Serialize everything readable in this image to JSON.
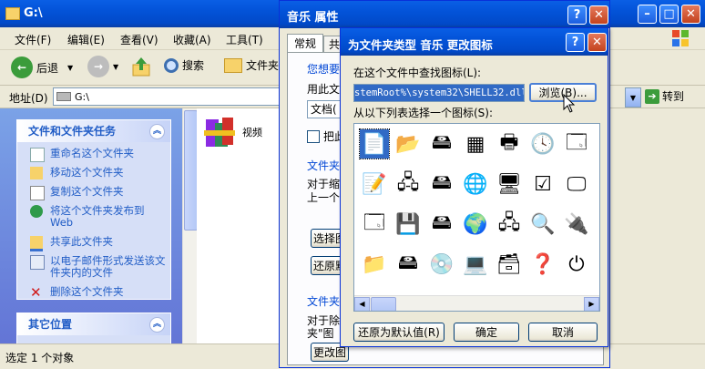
{
  "explorer": {
    "title": "G:\\",
    "menu": [
      "文件(F)",
      "编辑(E)",
      "查看(V)",
      "收藏(A)",
      "工具(T)"
    ],
    "toolbar": {
      "back": "后退",
      "search": "搜索",
      "folders": "文件夹"
    },
    "address": {
      "label": "地址(D)",
      "value": "G:\\",
      "go": "转到"
    },
    "tasks_panel": {
      "title": "文件和文件夹任务",
      "items": [
        "重命名这个文件夹",
        "移动这个文件夹",
        "复制这个文件夹",
        "将这个文件夹发布到Web",
        "共享此文件夹",
        "以电子邮件形式发送该文件夹内的文件",
        "删除这个文件夹"
      ]
    },
    "other_panel": {
      "title": "其它位置"
    },
    "file_item": "视频",
    "status": "选定 1 个对象"
  },
  "properties": {
    "title": "音乐 属性",
    "tabs": [
      "常规",
      "共"
    ],
    "labels": [
      "您想要",
      "用此文",
      "文档(",
      "把此",
      "文件夹",
      "对于缩",
      "上一个",
      "选择图",
      "还原默",
      "文件夹",
      "对于除",
      "夹\"图",
      "更改图"
    ]
  },
  "change_icon": {
    "title": "为文件夹类型 音乐 更改图标",
    "find_label": "在这个文件中查找图标(L):",
    "path_value": "stemRoot%\\system32\\SHELL32.dll",
    "browse": "浏览(B)...",
    "list_label": "从以下列表选择一个图标(S):",
    "restore": "还原为默认值(R)",
    "ok": "确定",
    "cancel": "取消"
  },
  "icons": [
    "document-icon",
    "folder-open-icon",
    "drive-icon",
    "chip-icon",
    "printer-icon",
    "clock-icon",
    "window-icon",
    "report-icon",
    "network-drive-icon",
    "share-drive-icon",
    "globe-icon",
    "monitor-icon",
    "check-icon",
    "screen-icon",
    "window-list-icon",
    "floppy-icon",
    "drive-x-icon",
    "globe-drive-icon",
    "network-icon",
    "magnifier-icon",
    "cable-icon",
    "folder-icon",
    "drive-flat-icon",
    "cd-icon",
    "computer-icon",
    "control-panel-icon",
    "help-icon",
    "power-icon"
  ]
}
